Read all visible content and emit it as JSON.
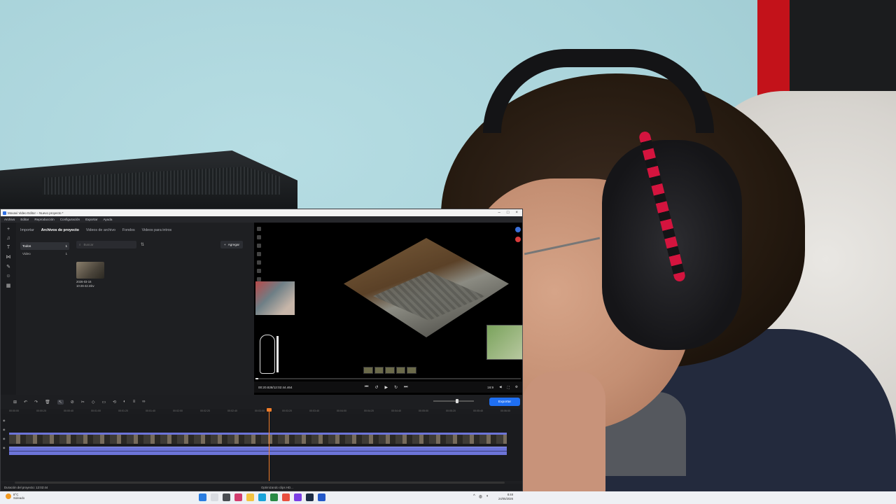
{
  "window": {
    "title": "Movavi Video Editor – Nuevo proyecto *",
    "menu": [
      "Archivo",
      "Editar",
      "Reproducción",
      "Configuración",
      "Exportar",
      "Ayuda"
    ]
  },
  "media": {
    "tabs": [
      "Importar",
      "Archivos de proyecto",
      "Videos de archivo",
      "Fondos",
      "Videos para intros"
    ],
    "active_tab": "Archivos de proyecto",
    "categories": [
      {
        "label": "Todos",
        "count": "1"
      },
      {
        "label": "Video",
        "count": "1"
      }
    ],
    "search_placeholder": "Buscar",
    "add_button": "Agregar",
    "file": {
      "date": "2026-03-16",
      "time": "10-26-42.mkv"
    }
  },
  "preview": {
    "time": "00:20.828/12:02:44.464",
    "aspect": "16:9"
  },
  "timeline": {
    "export_button": "Exportar",
    "ruler_ticks": [
      "00:00:00",
      "00:00:20",
      "00:00:40",
      "00:01:00",
      "00:01:20",
      "00:01:40",
      "00:02:00",
      "00:02:20",
      "00:02:40",
      "00:03:00",
      "00:03:20",
      "00:03:40",
      "00:04:00",
      "00:04:20",
      "00:04:40",
      "00:05:00",
      "00:05:20",
      "00:05:40",
      "00:06:00"
    ]
  },
  "status": {
    "duration": "Duración del proyecto: 12:02:44",
    "center": "Optimizando clips HD..."
  },
  "taskbar": {
    "weather_temp": "8°C",
    "weather_desc": "Soleado",
    "clock_time": "8:48",
    "clock_date": "24/05/2026"
  },
  "colors": {
    "accent": "#1f6ff2",
    "playhead": "#f07d2a",
    "clip": "#6c74d8"
  }
}
